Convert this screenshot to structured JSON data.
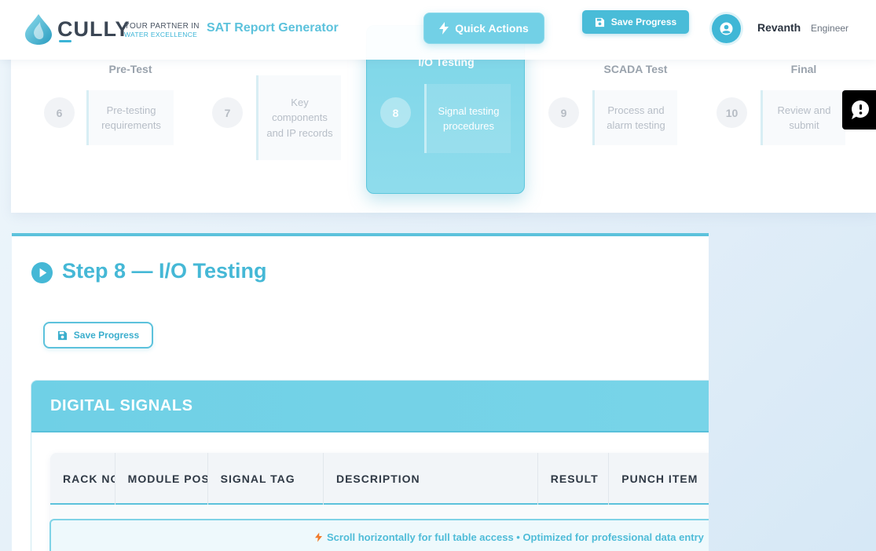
{
  "header": {
    "logo_word": "CULLY",
    "logo_tagline_1": "YOUR PARTNER IN",
    "logo_tagline_2": "WATER EXCELLENCE",
    "app_title": "SAT Report Generator",
    "quick_actions_label": "Quick Actions",
    "save_label": "Save Progress",
    "user_name": "Revanth",
    "user_role": "Engineer"
  },
  "stepper": {
    "steps": [
      {
        "title": "Pre-Test",
        "number": "6",
        "desc": "Pre-testing requirements"
      },
      {
        "title": "",
        "number": "7",
        "desc": "Key components and IP records"
      },
      {
        "title": "I/O Testing",
        "number": "8",
        "desc": "Signal testing procedures"
      },
      {
        "title": "SCADA Test",
        "number": "9",
        "desc": "Process and alarm testing"
      },
      {
        "title": "Final",
        "number": "10",
        "desc": "Review and submit"
      }
    ]
  },
  "main": {
    "step_heading": "Step 8 — I/O Testing",
    "save_label": "Save Progress",
    "section_title": "DIGITAL SIGNALS",
    "table_columns": [
      "RACK NO",
      "MODULE POSITION",
      "SIGNAL TAG",
      "DESCRIPTION",
      "RESULT",
      "PUNCH ITEM"
    ],
    "scroll_hint": "Scroll horizontally for full table access • Optimized for professional data entry"
  },
  "icons": {
    "quick_actions": "bolt-icon",
    "save": "floppy-disk-icon",
    "avatar": "user-circle-icon",
    "heading": "play-circle-icon",
    "chat": "chat-bubble-icon",
    "hint": "bolt-icon"
  },
  "colors": {
    "accent": "#5cc2dc",
    "accent_dark": "#45b8d6",
    "hint_bolt": "#f07a2a"
  }
}
